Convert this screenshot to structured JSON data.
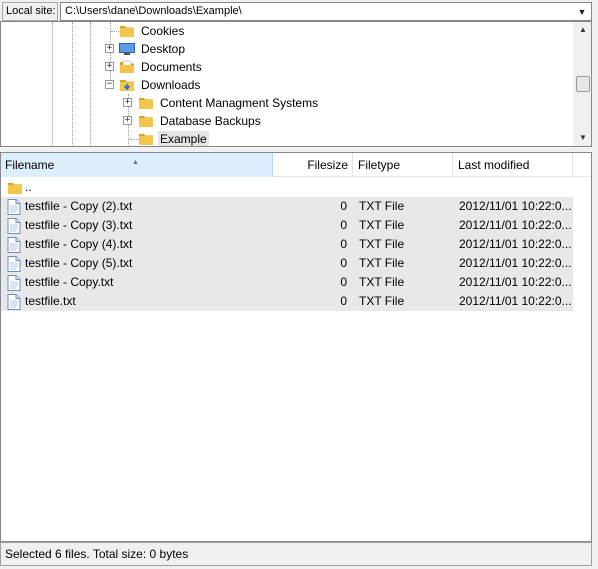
{
  "local_site": {
    "label": "Local site:",
    "path": "C:\\Users\\dane\\Downloads\\Example\\"
  },
  "tree": {
    "nodes": [
      {
        "name": "Cookies",
        "expander": "",
        "icon": "folder-icon"
      },
      {
        "name": "Desktop",
        "expander": "+",
        "icon": "desktop-icon"
      },
      {
        "name": "Documents",
        "expander": "+",
        "icon": "documents-folder-icon"
      },
      {
        "name": "Downloads",
        "expander": "−",
        "icon": "downloads-folder-icon"
      },
      {
        "name": "Content Managment Systems",
        "expander": "+",
        "icon": "folder-icon"
      },
      {
        "name": "Database Backups",
        "expander": "+",
        "icon": "folder-icon"
      },
      {
        "name": "Example",
        "expander": "",
        "icon": "folder-icon",
        "selected": true
      }
    ]
  },
  "file_list": {
    "columns": {
      "filename": "Filename",
      "filesize": "Filesize",
      "filetype": "Filetype",
      "last_modified": "Last modified"
    },
    "sort_indicator": "▲",
    "parent_row": {
      "name": ".."
    },
    "rows": [
      {
        "name": "testfile - Copy (2).txt",
        "size": "0",
        "type": "TXT File",
        "modified": "2012/11/01 10:22:0..."
      },
      {
        "name": "testfile - Copy (3).txt",
        "size": "0",
        "type": "TXT File",
        "modified": "2012/11/01 10:22:0..."
      },
      {
        "name": "testfile - Copy (4).txt",
        "size": "0",
        "type": "TXT File",
        "modified": "2012/11/01 10:22:0..."
      },
      {
        "name": "testfile - Copy (5).txt",
        "size": "0",
        "type": "TXT File",
        "modified": "2012/11/01 10:22:0..."
      },
      {
        "name": "testfile - Copy.txt",
        "size": "0",
        "type": "TXT File",
        "modified": "2012/11/01 10:22:0..."
      },
      {
        "name": "testfile.txt",
        "size": "0",
        "type": "TXT File",
        "modified": "2012/11/01 10:22:0..."
      }
    ]
  },
  "status": {
    "text": "Selected 6 files. Total size: 0 bytes"
  },
  "colors": {
    "folder": "#f3c64b",
    "folder_dark": "#d9a520",
    "selection": "#e8e8e8",
    "header_active": "#dceefb"
  }
}
